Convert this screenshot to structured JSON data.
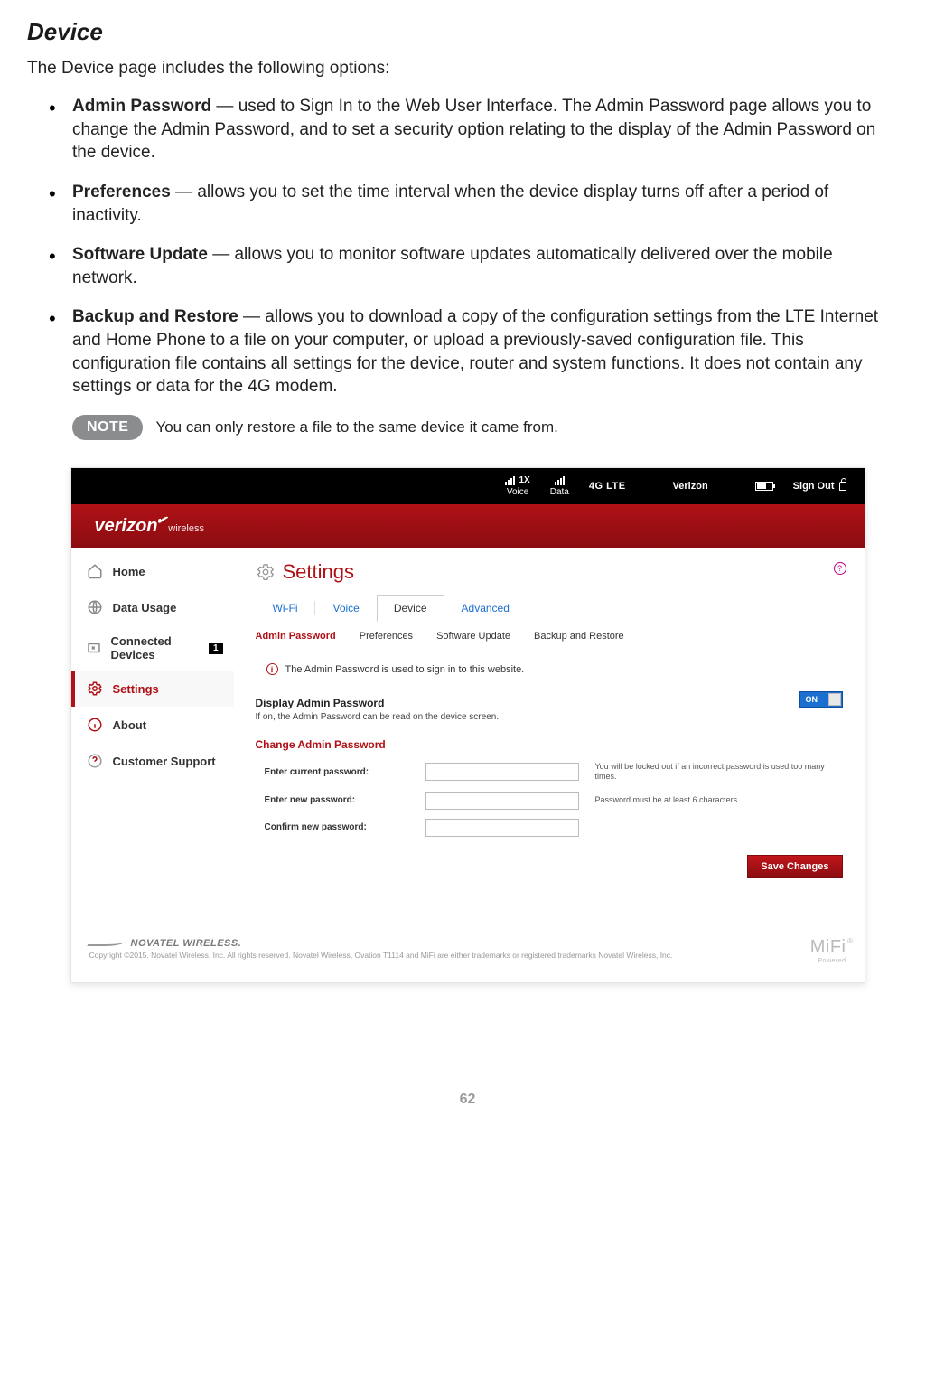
{
  "heading": "Device",
  "intro": "The Device page includes the following options:",
  "options": [
    {
      "label": "Admin Password",
      "text": " — used to Sign In to the Web User Interface. The Admin Password page allows you to change the Admin Password, and to set a security option relating to the display of the Admin Password on the device."
    },
    {
      "label": "Preferences",
      "text": " — allows you to set the time interval when the device display turns off after a period of inactivity."
    },
    {
      "label": "Software Update",
      "text": " — allows you to monitor software updates automatically delivered over the mobile network."
    },
    {
      "label": "Backup and Restore",
      "text": " — allows you to download a copy of the configuration settings from the LTE Internet and Home Phone to a file on your computer, or upload a previously-saved configuration file. This configuration file contains all settings for the device, router and system functions. It does not contain any settings or data for the 4G modem."
    }
  ],
  "note": {
    "badge": "NOTE",
    "text": "You can only restore a file to the same device it came from."
  },
  "topbar": {
    "voice_label": "Voice",
    "voice_net": "1X",
    "data_label": "Data",
    "lte": "4G LTE",
    "carrier": "Verizon",
    "sign_out": "Sign Out"
  },
  "brand": {
    "main": "verizon",
    "sub": "wireless"
  },
  "sidebar": {
    "items": [
      {
        "label": "Home"
      },
      {
        "label": "Data Usage"
      },
      {
        "label": "Connected Devices",
        "count": "1"
      },
      {
        "label": "Settings"
      },
      {
        "label": "About"
      },
      {
        "label": "Customer Support"
      }
    ]
  },
  "settings_title": "Settings",
  "tabs1": [
    "Wi-Fi",
    "Voice",
    "Device",
    "Advanced"
  ],
  "tabs2": [
    "Admin Password",
    "Preferences",
    "Software Update",
    "Backup and Restore"
  ],
  "info_text": "The Admin Password is used to sign in to this website.",
  "display_pw": {
    "heading": "Display Admin Password",
    "sub": "If on, the Admin Password can be read on the device screen.",
    "toggle": "ON"
  },
  "change_pw": {
    "heading": "Change Admin Password",
    "row1_label": "Enter current password:",
    "row1_hint": "You will be locked out if an incorrect password is used too many times.",
    "row2_label": "Enter new password:",
    "row2_hint": "Password must be at least 6 characters.",
    "row3_label": "Confirm new password:"
  },
  "save_btn": "Save Changes",
  "footer": {
    "brand": "NOVATEL WIRELESS.",
    "copy": "Copyright ©2015. Novatel Wireless, Inc. All rights reserved. Novatel Wireless, Ovation T1114 and MiFi are either trademarks or registered trademarks Novatel Wireless, Inc.",
    "mifi": "MiFi",
    "powered": "Powered"
  },
  "page_num": "62"
}
